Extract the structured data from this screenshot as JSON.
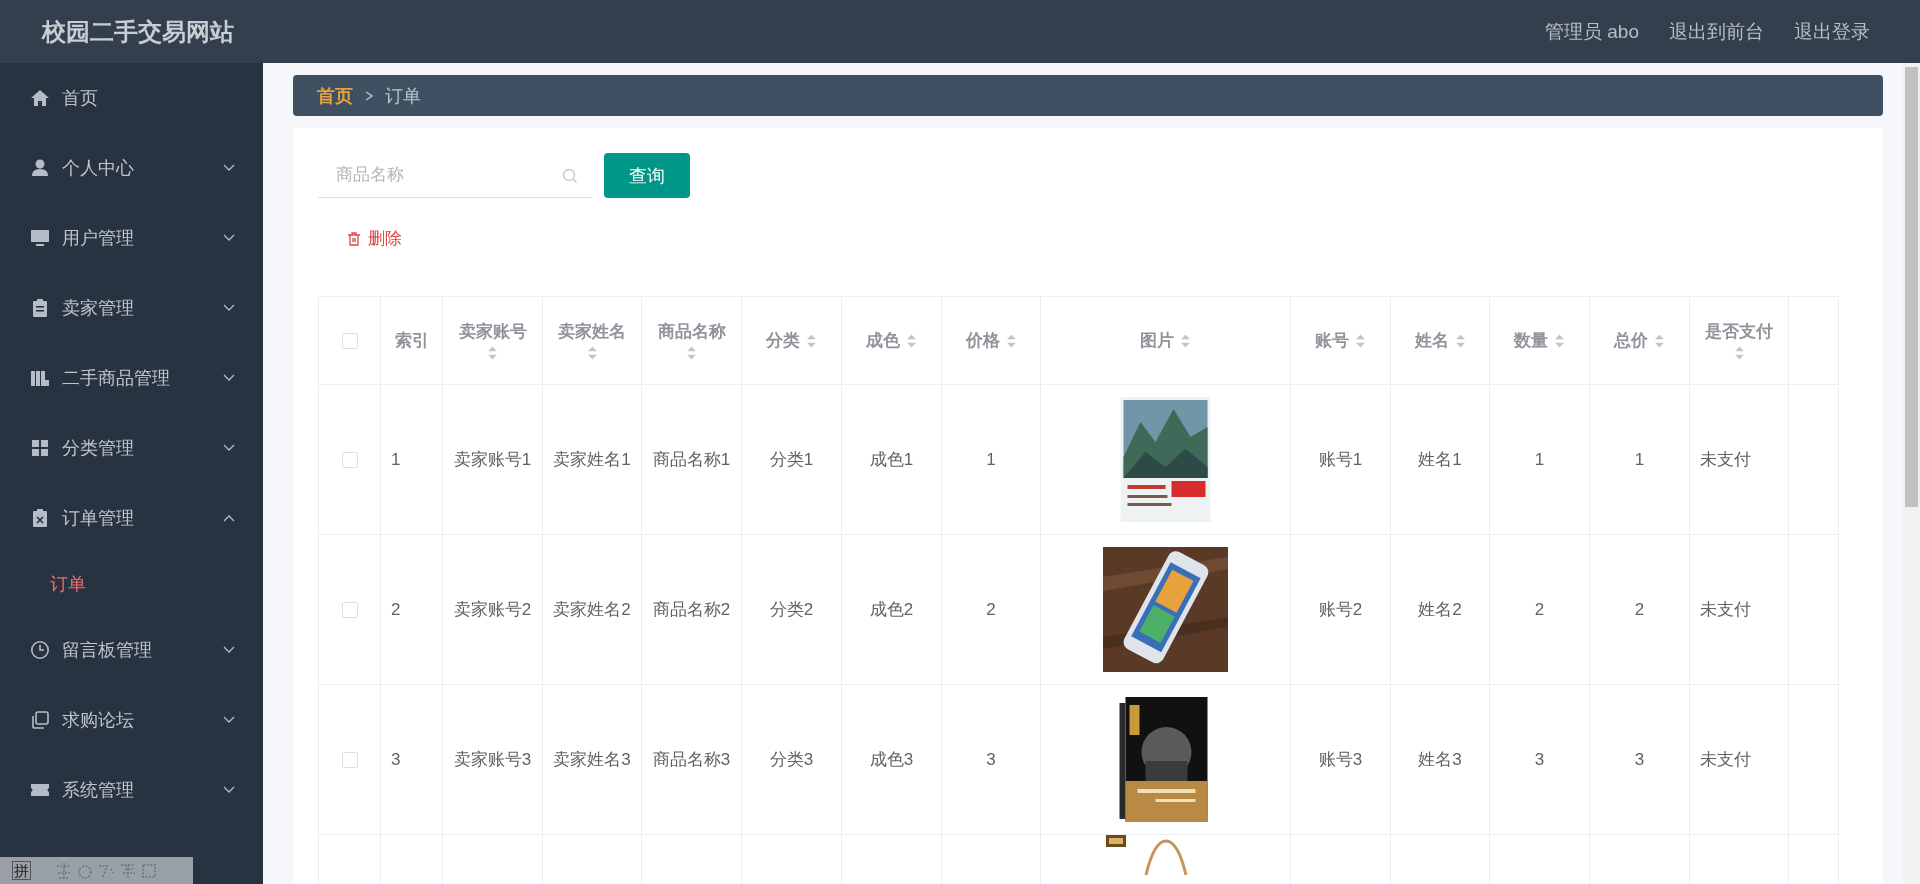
{
  "header": {
    "title": "校园二手交易网站",
    "user": "管理员 abo",
    "links": [
      "退出到前台",
      "退出登录"
    ]
  },
  "sidebar": {
    "items": [
      {
        "label": "首页",
        "kind": "home",
        "expandable": false
      },
      {
        "label": "个人中心",
        "kind": "user",
        "expandable": true,
        "expanded": false
      },
      {
        "label": "用户管理",
        "kind": "monitor",
        "expandable": true,
        "expanded": false
      },
      {
        "label": "卖家管理",
        "kind": "clipboard",
        "expandable": true,
        "expanded": false
      },
      {
        "label": "二手商品管理",
        "kind": "books",
        "expandable": true,
        "expanded": false
      },
      {
        "label": "分类管理",
        "kind": "grid",
        "expandable": true,
        "expanded": false
      },
      {
        "label": "订单管理",
        "kind": "clipboard-x",
        "expandable": true,
        "expanded": true,
        "children": [
          {
            "label": "订单",
            "selected": true
          }
        ]
      },
      {
        "label": "留言板管理",
        "kind": "clock",
        "expandable": true,
        "expanded": false
      },
      {
        "label": "求购论坛",
        "kind": "copy",
        "expandable": true,
        "expanded": false
      },
      {
        "label": "系统管理",
        "kind": "ticket",
        "expandable": true,
        "expanded": false
      }
    ]
  },
  "breadcrumb": [
    "首页",
    "订单"
  ],
  "search": {
    "placeholder": "商品名称",
    "button": "查询"
  },
  "delete_button": "删除",
  "table": {
    "columns": [
      {
        "kind": "checkbox",
        "checked": false
      },
      {
        "label": "索引",
        "sortable": false
      },
      {
        "label": "卖家账号",
        "sortable": true
      },
      {
        "label": "卖家姓名",
        "sortable": true
      },
      {
        "label": "商品名称",
        "sortable": true
      },
      {
        "label": "分类",
        "sortable": true
      },
      {
        "label": "成色",
        "sortable": true
      },
      {
        "label": "价格",
        "sortable": true
      },
      {
        "label": "图片",
        "sortable": true
      },
      {
        "label": "账号",
        "sortable": true
      },
      {
        "label": "姓名",
        "sortable": true
      },
      {
        "label": "数量",
        "sortable": true
      },
      {
        "label": "总价",
        "sortable": true
      },
      {
        "label": "是否支付",
        "sortable": true
      },
      {}
    ],
    "rows": [
      {
        "cells": [
          {
            "kind": "checkbox",
            "checked": false
          },
          "1",
          "卖家账号1",
          "卖家姓名1",
          "商品名称1",
          "分类1",
          "成色1",
          "1",
          {
            "kind": "picture"
          },
          "账号1",
          "姓名1",
          "1",
          "1",
          "未支付"
        ]
      },
      {
        "cells": [
          {
            "kind": "checkbox",
            "checked": false
          },
          "2",
          "卖家账号2",
          "卖家姓名2",
          "商品名称2",
          "分类2",
          "成色2",
          "2",
          {
            "kind": "picture"
          },
          "账号2",
          "姓名2",
          "2",
          "2",
          "未支付"
        ]
      },
      {
        "cells": [
          {
            "kind": "checkbox",
            "checked": false
          },
          "3",
          "卖家账号3",
          "卖家姓名3",
          "商品名称3",
          "分类3",
          "成色3",
          "3",
          {
            "kind": "picture"
          },
          "账号3",
          "姓名3",
          "3",
          "3",
          "未支付"
        ]
      },
      {
        "partial": true,
        "cells": [
          null,
          null,
          null,
          null,
          null,
          null,
          null,
          null,
          {
            "kind": "picture"
          }
        ]
      }
    ]
  },
  "ime_bar": {
    "mode": "拼"
  }
}
